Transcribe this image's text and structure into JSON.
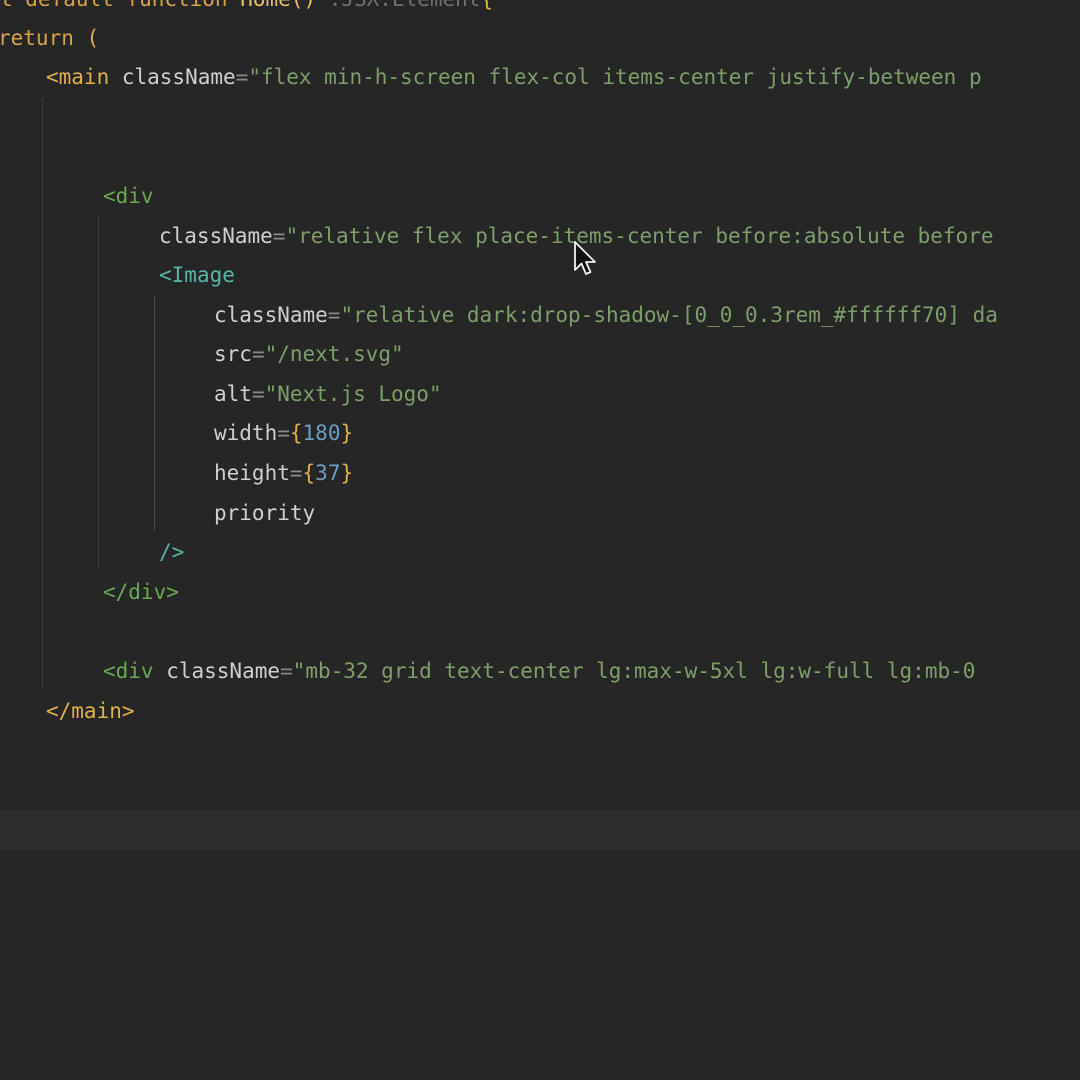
{
  "editor": {
    "lines": {
      "l0": {
        "kw1": "t default function ",
        "fn": "Home",
        "paren": "()",
        "hint": " :JSX.Element",
        "brace": "{"
      },
      "l1": {
        "kw": "return",
        "paren": " ("
      },
      "l2": {
        "open": "<main",
        "attr": " className",
        "eq": "=",
        "str": "\"flex min-h-screen flex-col items-center justify-between p"
      },
      "l5": {
        "open": "<div"
      },
      "l6": {
        "attr": "className",
        "eq": "=",
        "str": "\"relative flex place-items-center before:absolute before"
      },
      "l7": {
        "open": "<",
        "comp": "Image"
      },
      "l8": {
        "attr": "className",
        "eq": "=",
        "str": "\"relative dark:drop-shadow-[0_0_0.3rem_#ffffff70] da"
      },
      "l9": {
        "attr": "src",
        "eq": "=",
        "str": "\"/next.svg\""
      },
      "l10": {
        "attr": "alt",
        "eq": "=",
        "str": "\"Next.js Logo\""
      },
      "l11": {
        "attr": "width",
        "eq": "=",
        "lb": "{",
        "num": "180",
        "rb": "}"
      },
      "l12": {
        "attr": "height",
        "eq": "=",
        "lb": "{",
        "num": "37",
        "rb": "}"
      },
      "l13": {
        "attr": "priority"
      },
      "l14": {
        "close": "/>"
      },
      "l15": {
        "close": "</div>"
      },
      "l17": {
        "open": "<div",
        "attr": " className",
        "eq": "=",
        "str": "\"mb-32 grid text-center lg:max-w-5xl lg:w-full lg:mb-0"
      },
      "l18": {
        "close": "</main>"
      }
    }
  },
  "icons": {
    "cursor": "mouse-pointer-icon"
  }
}
